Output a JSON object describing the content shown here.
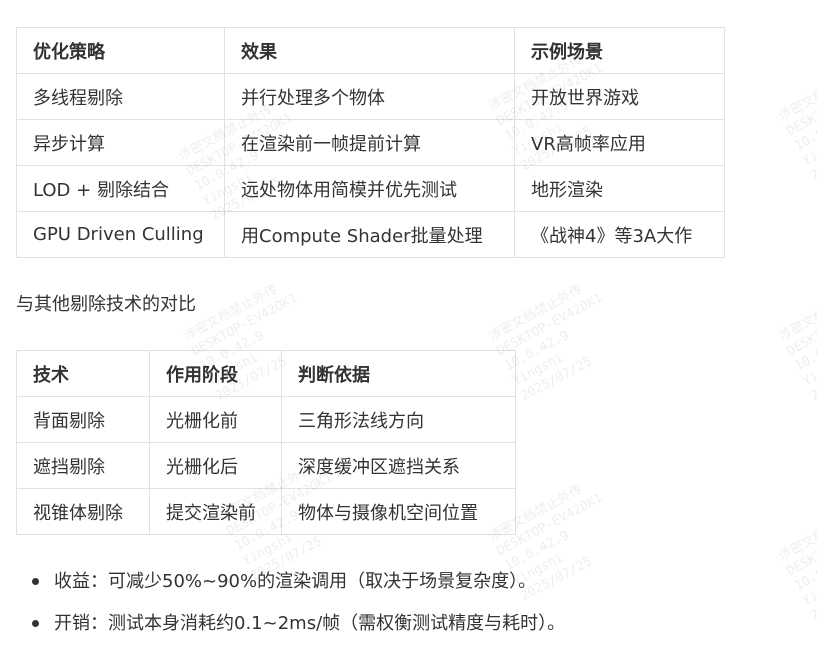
{
  "table_strategies": {
    "headers": [
      "优化策略",
      "效果",
      "示例场景"
    ],
    "rows": [
      [
        "多线程剔除",
        "并行处理多个物体",
        "开放世界游戏"
      ],
      [
        "异步计算",
        "在渲染前一帧提前计算",
        "VR高帧率应用"
      ],
      [
        "LOD + 剔除结合",
        "远处物体用简模并优先测试",
        "地形渲染"
      ],
      [
        "GPU Driven Culling",
        "用Compute Shader批量处理",
        "《战神4》等3A大作"
      ]
    ]
  },
  "comparison_heading": "与其他剔除技术的对比",
  "table_comparison": {
    "headers": [
      "技术",
      "作用阶段",
      "判断依据"
    ],
    "rows": [
      [
        "背面剔除",
        "光栅化前",
        "三角形法线方向"
      ],
      [
        "遮挡剔除",
        "光栅化后",
        "深度缓冲区遮挡关系"
      ],
      [
        "视锥体剔除",
        "提交渲染前",
        "物体与摄像机空间位置"
      ]
    ]
  },
  "bullets": [
    "收益：可减少50%~90%的渲染调用（取决于场景复杂度）。",
    "开销：测试本身消耗约0.1~2ms/帧（需权衡测试精度与耗时）。"
  ],
  "watermark": {
    "lines": [
      "涉密文档禁止外传",
      "DESKTOP-EV42OK1",
      "10.0.42.9",
      "Yingshi",
      "2025/07/25"
    ]
  }
}
